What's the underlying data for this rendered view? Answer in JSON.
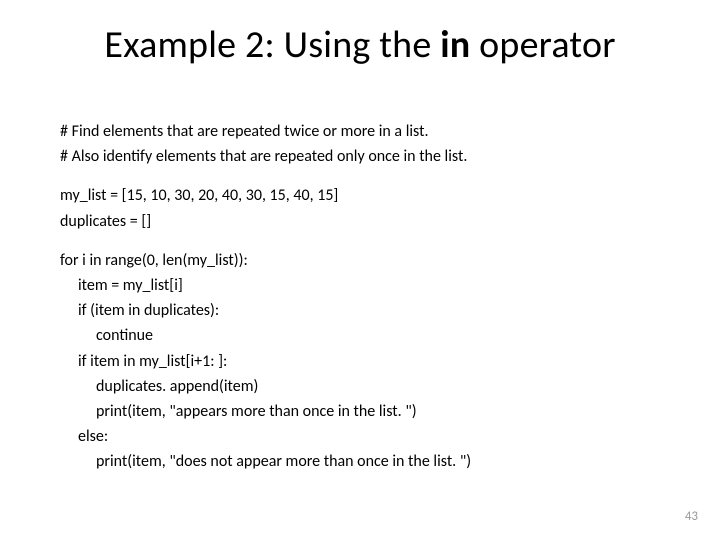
{
  "title_prefix": "Example 2: Using the ",
  "title_kw": "in",
  "title_suffix": " operator",
  "lines": {
    "c1": "# Find elements that are repeated twice or more in a list.",
    "c2": "# Also identify elements that are repeated only once in the list.",
    "l1": "my_list = [15, 10, 30, 20, 40, 30, 15, 40, 15]",
    "l2": "duplicates = []",
    "l3": "for i in range(0, len(my_list)):",
    "l4": "item = my_list[i]",
    "l5": "if (item in duplicates):",
    "l6": "continue",
    "l7": "if item in my_list[i+1: ]:",
    "l8": "duplicates. append(item)",
    "l9": "print(item, \"appears more than once in the list. \")",
    "l10": "else:",
    "l11": "print(item, \"does not appear more than once in the list. \")"
  },
  "page_number": "43"
}
